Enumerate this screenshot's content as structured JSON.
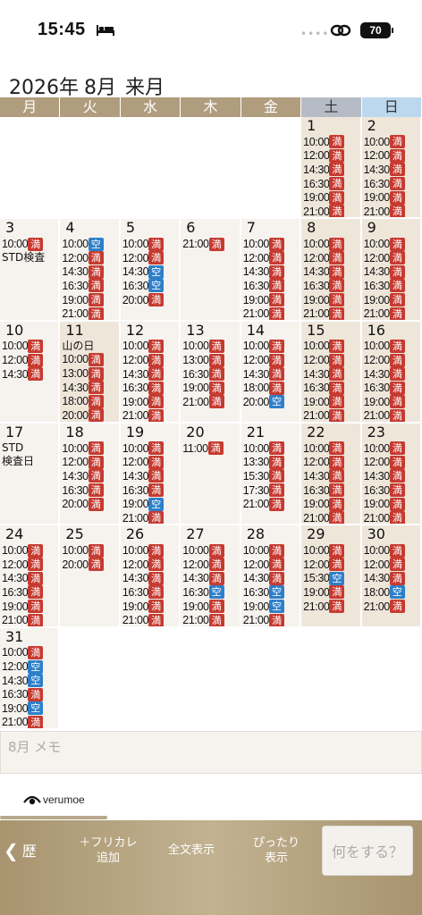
{
  "status_bar": {
    "time": "15:45",
    "battery": "70"
  },
  "header": {
    "year": "2026年",
    "month": "8月",
    "next_label": "来月"
  },
  "weekdays": [
    "月",
    "火",
    "水",
    "木",
    "金",
    "土",
    "日"
  ],
  "badges": {
    "full": "満",
    "open": "空"
  },
  "days": [
    null,
    null,
    null,
    null,
    null,
    {
      "day": "1",
      "weekend": true,
      "slots": [
        [
          "10:00",
          "full"
        ],
        [
          "12:00",
          "full"
        ],
        [
          "14:30",
          "full"
        ],
        [
          "16:30",
          "full"
        ],
        [
          "19:00",
          "full"
        ],
        [
          "21:00",
          "full"
        ]
      ]
    },
    {
      "day": "2",
      "weekend": true,
      "slots": [
        [
          "10:00",
          "full"
        ],
        [
          "12:00",
          "full"
        ],
        [
          "14:30",
          "full"
        ],
        [
          "16:30",
          "full"
        ],
        [
          "19:00",
          "full"
        ],
        [
          "21:00",
          "full"
        ]
      ]
    },
    {
      "day": "3",
      "slots": [
        [
          "10:00",
          "full"
        ]
      ],
      "note": "STD検査"
    },
    {
      "day": "4",
      "slots": [
        [
          "10:00",
          "open"
        ],
        [
          "12:00",
          "full"
        ],
        [
          "14:30",
          "full"
        ],
        [
          "16:30",
          "full"
        ],
        [
          "19:00",
          "full"
        ],
        [
          "21:00",
          "full"
        ]
      ]
    },
    {
      "day": "5",
      "slots": [
        [
          "10:00",
          "full"
        ],
        [
          "12:00",
          "full"
        ],
        [
          "14:30",
          "open"
        ],
        [
          "16:30",
          "open"
        ],
        [
          "20:00",
          "full"
        ]
      ]
    },
    {
      "day": "6",
      "slots": [
        [
          "21:00",
          "full"
        ]
      ]
    },
    {
      "day": "7",
      "slots": [
        [
          "10:00",
          "full"
        ],
        [
          "12:00",
          "full"
        ],
        [
          "14:30",
          "full"
        ],
        [
          "16:30",
          "full"
        ],
        [
          "19:00",
          "full"
        ],
        [
          "21:00",
          "full"
        ]
      ]
    },
    {
      "day": "8",
      "weekend": true,
      "slots": [
        [
          "10:00",
          "full"
        ],
        [
          "12:00",
          "full"
        ],
        [
          "14:30",
          "full"
        ],
        [
          "16:30",
          "full"
        ],
        [
          "19:00",
          "full"
        ],
        [
          "21:00",
          "full"
        ]
      ]
    },
    {
      "day": "9",
      "weekend": true,
      "slots": [
        [
          "10:00",
          "full"
        ],
        [
          "12:00",
          "full"
        ],
        [
          "14:30",
          "full"
        ],
        [
          "16:30",
          "full"
        ],
        [
          "19:00",
          "full"
        ],
        [
          "21:00",
          "full"
        ]
      ]
    },
    {
      "day": "10",
      "slots": [
        [
          "10:00",
          "full"
        ],
        [
          "12:00",
          "full"
        ],
        [
          "14:30",
          "full"
        ]
      ]
    },
    {
      "day": "11",
      "holiday": true,
      "holiday_name": "山の日",
      "slots": [
        [
          "10:00",
          "full"
        ],
        [
          "13:00",
          "full"
        ],
        [
          "14:30",
          "full"
        ],
        [
          "18:00",
          "full"
        ],
        [
          "20:00",
          "full"
        ]
      ]
    },
    {
      "day": "12",
      "slots": [
        [
          "10:00",
          "full"
        ],
        [
          "12:00",
          "full"
        ],
        [
          "14:30",
          "full"
        ],
        [
          "16:30",
          "full"
        ],
        [
          "19:00",
          "full"
        ],
        [
          "21:00",
          "full"
        ]
      ]
    },
    {
      "day": "13",
      "slots": [
        [
          "10:00",
          "full"
        ],
        [
          "13:00",
          "full"
        ],
        [
          "16:30",
          "full"
        ],
        [
          "19:00",
          "full"
        ],
        [
          "21:00",
          "full"
        ]
      ]
    },
    {
      "day": "14",
      "slots": [
        [
          "10:00",
          "full"
        ],
        [
          "12:00",
          "full"
        ],
        [
          "14:30",
          "full"
        ],
        [
          "18:00",
          "full"
        ],
        [
          "20:00",
          "open"
        ]
      ]
    },
    {
      "day": "15",
      "weekend": true,
      "slots": [
        [
          "10:00",
          "full"
        ],
        [
          "12:00",
          "full"
        ],
        [
          "14:30",
          "full"
        ],
        [
          "16:30",
          "full"
        ],
        [
          "19:00",
          "full"
        ],
        [
          "21:00",
          "full"
        ]
      ]
    },
    {
      "day": "16",
      "weekend": true,
      "slots": [
        [
          "10:00",
          "full"
        ],
        [
          "12:00",
          "full"
        ],
        [
          "14:30",
          "full"
        ],
        [
          "16:30",
          "full"
        ],
        [
          "19:00",
          "full"
        ],
        [
          "21:00",
          "full"
        ]
      ]
    },
    {
      "day": "17",
      "slots": [],
      "note": "STD",
      "note2": "検査日"
    },
    {
      "day": "18",
      "slots": [
        [
          "10:00",
          "full"
        ],
        [
          "12:00",
          "full"
        ],
        [
          "14:30",
          "full"
        ],
        [
          "16:30",
          "full"
        ],
        [
          "20:00",
          "full"
        ]
      ]
    },
    {
      "day": "19",
      "slots": [
        [
          "10:00",
          "full"
        ],
        [
          "12:00",
          "full"
        ],
        [
          "14:30",
          "full"
        ],
        [
          "16:30",
          "full"
        ],
        [
          "19:00",
          "open"
        ],
        [
          "21:00",
          "full"
        ]
      ]
    },
    {
      "day": "20",
      "slots": [
        [
          "11:00",
          "full"
        ]
      ]
    },
    {
      "day": "21",
      "slots": [
        [
          "10:00",
          "full"
        ],
        [
          "13:30",
          "full"
        ],
        [
          "15:30",
          "full"
        ],
        [
          "17:30",
          "full"
        ],
        [
          "21:00",
          "full"
        ]
      ]
    },
    {
      "day": "22",
      "weekend": true,
      "slots": [
        [
          "10:00",
          "full"
        ],
        [
          "12:00",
          "full"
        ],
        [
          "14:30",
          "full"
        ],
        [
          "16:30",
          "full"
        ],
        [
          "19:00",
          "full"
        ],
        [
          "21:00",
          "full"
        ]
      ]
    },
    {
      "day": "23",
      "weekend": true,
      "slots": [
        [
          "10:00",
          "full"
        ],
        [
          "12:00",
          "full"
        ],
        [
          "14:30",
          "full"
        ],
        [
          "16:30",
          "full"
        ],
        [
          "19:00",
          "full"
        ],
        [
          "21:00",
          "full"
        ]
      ]
    },
    {
      "day": "24",
      "slots": [
        [
          "10:00",
          "full"
        ],
        [
          "12:00",
          "full"
        ],
        [
          "14:30",
          "full"
        ],
        [
          "16:30",
          "full"
        ],
        [
          "19:00",
          "full"
        ],
        [
          "21:00",
          "full"
        ]
      ]
    },
    {
      "day": "25",
      "slots": [
        [
          "10:00",
          "full"
        ],
        [
          "20:00",
          "full"
        ]
      ]
    },
    {
      "day": "26",
      "slots": [
        [
          "10:00",
          "full"
        ],
        [
          "12:00",
          "full"
        ],
        [
          "14:30",
          "full"
        ],
        [
          "16:30",
          "full"
        ],
        [
          "19:00",
          "full"
        ],
        [
          "21:00",
          "full"
        ]
      ]
    },
    {
      "day": "27",
      "slots": [
        [
          "10:00",
          "full"
        ],
        [
          "12:00",
          "full"
        ],
        [
          "14:30",
          "full"
        ],
        [
          "16:30",
          "open"
        ],
        [
          "19:00",
          "full"
        ],
        [
          "21:00",
          "full"
        ]
      ]
    },
    {
      "day": "28",
      "slots": [
        [
          "10:00",
          "full"
        ],
        [
          "12:00",
          "full"
        ],
        [
          "14:30",
          "full"
        ],
        [
          "16:30",
          "open"
        ],
        [
          "19:00",
          "open"
        ],
        [
          "21:00",
          "full"
        ]
      ]
    },
    {
      "day": "29",
      "weekend": true,
      "slots": [
        [
          "10:00",
          "full"
        ],
        [
          "12:00",
          "full"
        ],
        [
          "15:30",
          "open"
        ],
        [
          "19:00",
          "full"
        ],
        [
          "21:00",
          "full"
        ]
      ]
    },
    {
      "day": "30",
      "weekend": true,
      "slots": [
        [
          "10:00",
          "full"
        ],
        [
          "12:00",
          "full"
        ],
        [
          "14:30",
          "full"
        ],
        [
          "18:00",
          "open"
        ],
        [
          "21:00",
          "full"
        ]
      ]
    },
    {
      "day": "31",
      "slots": [
        [
          "10:00",
          "full"
        ],
        [
          "12:00",
          "open"
        ],
        [
          "14:30",
          "open"
        ],
        [
          "16:30",
          "full"
        ],
        [
          "19:00",
          "open"
        ],
        [
          "21:00",
          "full"
        ]
      ]
    },
    null,
    null,
    null,
    null,
    null,
    null
  ],
  "memo": {
    "placeholder": "8月 メモ"
  },
  "logo": {
    "text": "verumoe"
  },
  "toolbar": {
    "back_label": "歴",
    "furigana_line1": "＋フリカレ",
    "furigana_line2": "追加",
    "fulltext_label": "全文表示",
    "fit_line1": "ぴったり",
    "fit_line2": "表示",
    "what_label": "何をする？"
  }
}
